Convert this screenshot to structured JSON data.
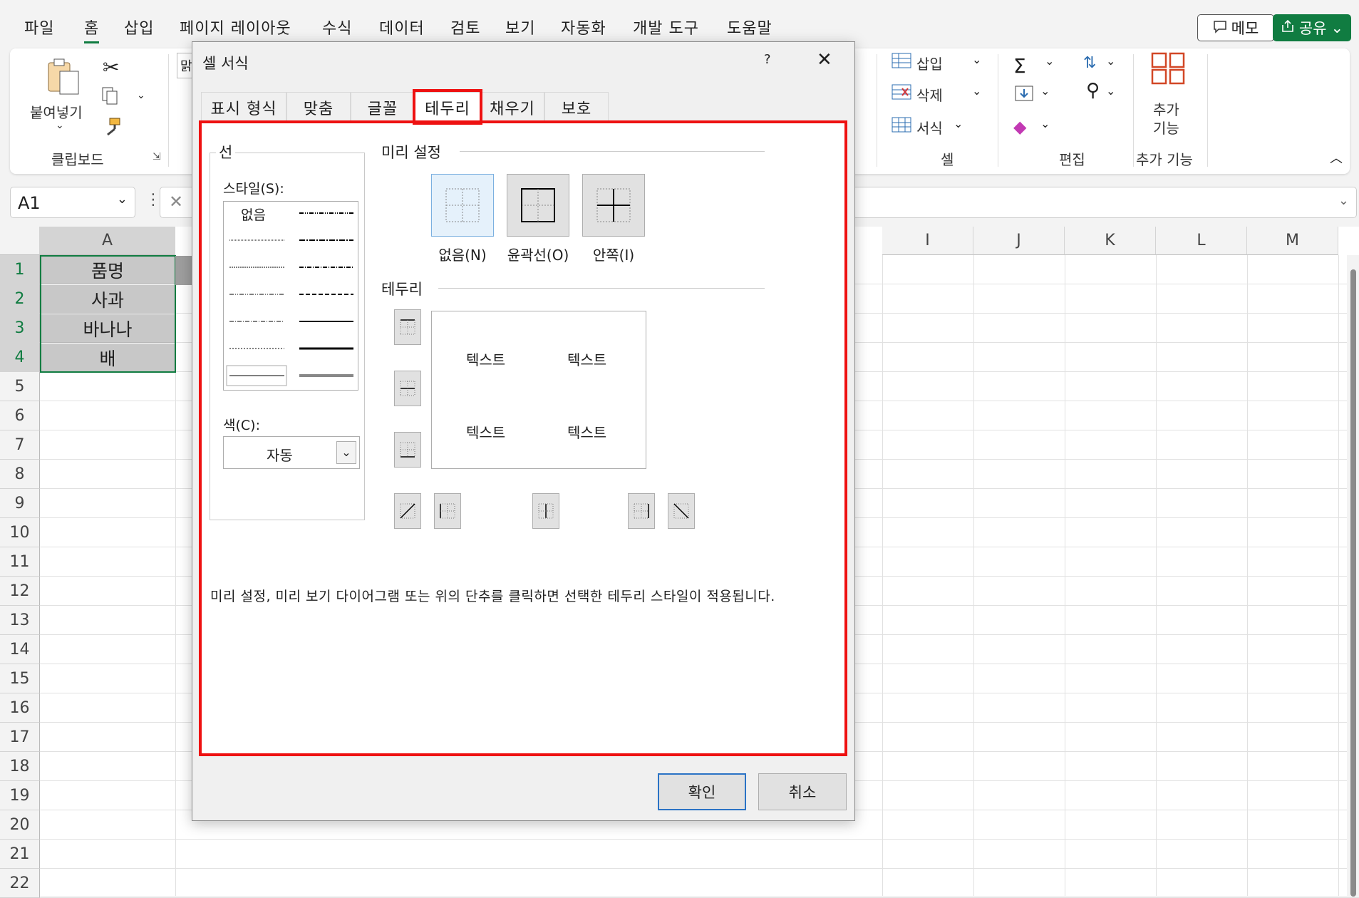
{
  "menu": {
    "items": [
      "파일",
      "홈",
      "삽입",
      "페이지 레이아웃",
      "수식",
      "데이터",
      "검토",
      "보기",
      "자동화",
      "개발 도구",
      "도움말"
    ],
    "active_index": 1,
    "memo": "메모",
    "share": "공유"
  },
  "ribbon": {
    "paste": "붙여넣기",
    "clipboard": "클립보드",
    "font_partial": "맑",
    "insert": "삽입",
    "delete": "삭제",
    "format": "서식",
    "cells": "셀",
    "editing": "편집",
    "addins_line1": "추가",
    "addins_line2": "기능",
    "addins_group": "추가 기능"
  },
  "namebox": {
    "value": "A1"
  },
  "grid": {
    "columns": [
      "A",
      "I",
      "J",
      "K",
      "L",
      "M"
    ],
    "rows": [
      "1",
      "2",
      "3",
      "4",
      "5",
      "6",
      "7",
      "8",
      "9",
      "10",
      "11",
      "12",
      "13",
      "14",
      "15",
      "16",
      "17",
      "18",
      "19",
      "20",
      "21",
      "22"
    ],
    "cells_A": [
      "품명",
      "사과",
      "바나나",
      "배"
    ]
  },
  "dialog": {
    "title": "셀 서식",
    "help": "?",
    "tabs": [
      "표시 형식",
      "맞춤",
      "글꼴",
      "테두리",
      "채우기",
      "보호"
    ],
    "active_tab": 3,
    "line_group": "선",
    "style_label": "스타일(S):",
    "style_none": "없음",
    "color_label": "색(C):",
    "color_value": "자동",
    "presets_label": "미리 설정",
    "presets": [
      "없음(N)",
      "윤곽선(O)",
      "안쪽(I)"
    ],
    "border_label": "테두리",
    "preview_text": [
      "텍스트",
      "텍스트",
      "텍스트",
      "텍스트"
    ],
    "hint": "미리 설정, 미리 보기 다이어그램 또는 위의 단추를 클릭하면 선택한 테두리 스타일이 적용됩니다.",
    "ok": "확인",
    "cancel": "취소"
  },
  "colors": {
    "accent_green": "#107c41",
    "highlight_red": "#ee1111",
    "selected_blue": "#2b73c5"
  }
}
